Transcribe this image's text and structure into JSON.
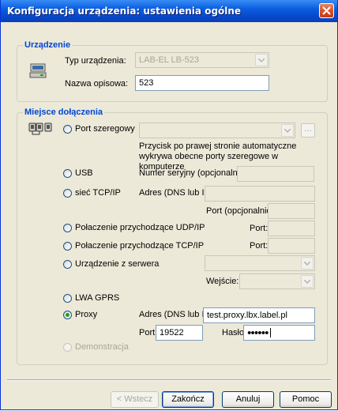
{
  "window": {
    "title": "Konfiguracja urządzenia: ustawienia ogólne"
  },
  "device": {
    "group_label": "Urządzenie",
    "type_label": "Typ urządzenia:",
    "type_value": "LAB-EL LB-523",
    "name_label": "Nazwa opisowa:",
    "name_value": "523"
  },
  "connection": {
    "group_label": "Miejsce dołączenia",
    "serial": {
      "label": "Port szeregowy",
      "selected": false,
      "port_value": "",
      "browse_label": "...",
      "hint": "Przycisk po prawej stronie automatyczne wykrywa obecne porty szeregowe w komputerze"
    },
    "usb": {
      "label": "USB",
      "selected": false,
      "serial_label": "Numer seryjny (opcjonalnie):",
      "serial_value": ""
    },
    "tcp": {
      "label": "sieć TCP/IP",
      "selected": false,
      "address_label": "Adres (DNS lub IP):",
      "address_value": "",
      "port_label": "Port (opcjonalnie):",
      "port_value": ""
    },
    "udp_in": {
      "label": "Połaczenie przychodzące UDP/IP",
      "selected": false,
      "port_label": "Port:",
      "port_value": ""
    },
    "tcp_in": {
      "label": "Połaczenie przychodzące TCP/IP",
      "selected": false,
      "port_label": "Port:",
      "port_value": ""
    },
    "server": {
      "label": "Urządzenie z serwera",
      "selected": false,
      "server_value": "",
      "inputs_label": "Wejście:",
      "inputs_value": ""
    },
    "gprs": {
      "label": "LWA GPRS",
      "selected": false
    },
    "proxy": {
      "label": "Proxy",
      "selected": true,
      "address_label": "Adres (DNS lub IP):",
      "address_value": "test.proxy.lbx.label.pl",
      "port_label": "Port :",
      "port_value": "19522",
      "password_label": "Hasło:",
      "password_value": "●●●●●●"
    },
    "demo": {
      "label": "Demonstracja",
      "selected": false
    }
  },
  "buttons": {
    "back": "< Wstecz",
    "finish": "Zakończ",
    "cancel": "Anuluj",
    "help": "Pomoc"
  }
}
